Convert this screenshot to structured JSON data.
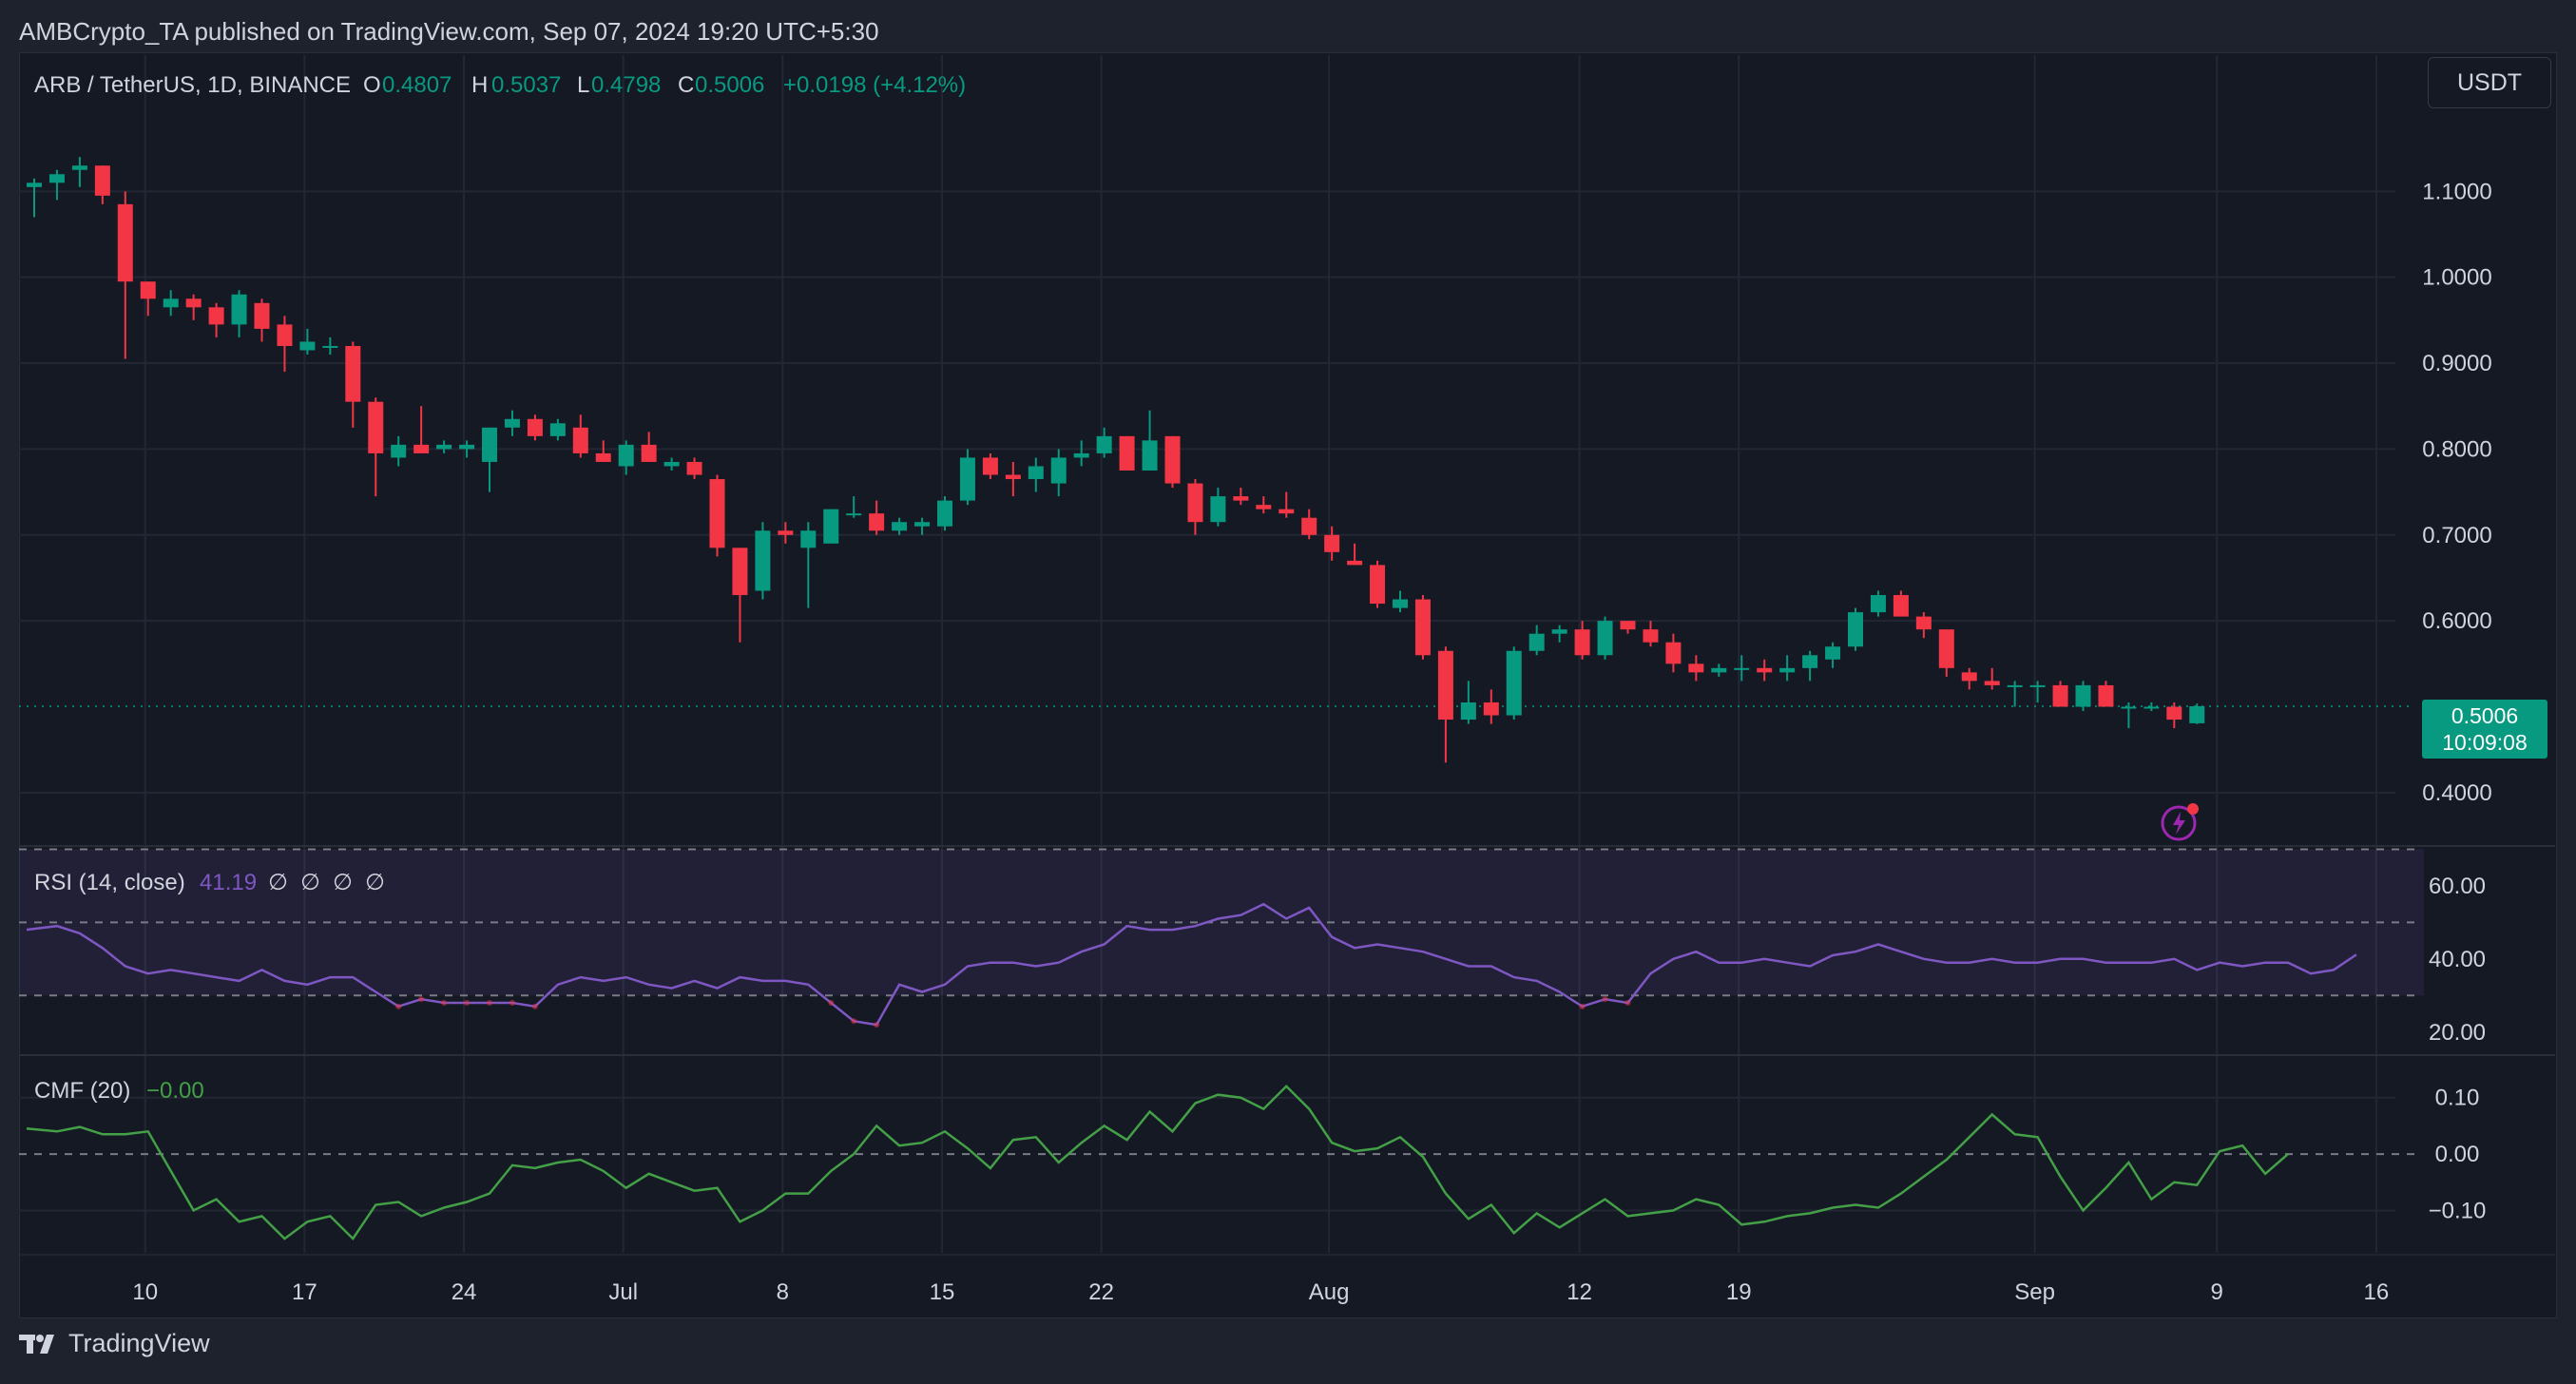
{
  "publisher": "AMBCrypto_TA published on TradingView.com, Sep 07, 2024 19:20 UTC+5:30",
  "header": {
    "symbol": "ARB / TetherUS, 1D, BINANCE",
    "o_label": "O",
    "o_value": "0.4807",
    "h_label": "H",
    "h_value": "0.5037",
    "l_label": "L",
    "l_value": "0.4798",
    "c_label": "C",
    "c_value": "0.5006",
    "change": "+0.0198 (+4.12%)"
  },
  "currency_button": "USDT",
  "price_badge": {
    "price": "0.5006",
    "countdown": "10:09:08"
  },
  "footer": {
    "brand": "TradingView"
  },
  "colors": {
    "up": "#089981",
    "down": "#f23645",
    "rsi": "#7e57c2",
    "cmf": "#43a047",
    "grid": "#232733",
    "text": "#d1d4dc"
  },
  "chart_data": [
    {
      "type": "candlestick",
      "title": "ARB / TetherUS, 1D, BINANCE",
      "y_ticks": [
        "1.1000",
        "1.0000",
        "0.9000",
        "0.8000",
        "0.7000",
        "0.6000",
        "0.4000"
      ],
      "ylim": [
        0.36,
        1.19
      ],
      "x_ticks": [
        "10",
        "17",
        "24",
        "Jul",
        "8",
        "15",
        "22",
        "Aug",
        "12",
        "19",
        "Sep",
        "9",
        "16"
      ],
      "ohlc": [
        [
          1.105,
          1.115,
          1.07,
          1.11
        ],
        [
          1.11,
          1.125,
          1.09,
          1.12
        ],
        [
          1.125,
          1.14,
          1.105,
          1.13
        ],
        [
          1.13,
          1.13,
          1.085,
          1.095
        ],
        [
          1.085,
          1.1,
          0.905,
          0.995
        ],
        [
          0.995,
          0.995,
          0.955,
          0.975
        ],
        [
          0.965,
          0.985,
          0.955,
          0.975
        ],
        [
          0.975,
          0.98,
          0.95,
          0.965
        ],
        [
          0.965,
          0.97,
          0.93,
          0.945
        ],
        [
          0.945,
          0.985,
          0.93,
          0.98
        ],
        [
          0.97,
          0.975,
          0.925,
          0.94
        ],
        [
          0.945,
          0.955,
          0.89,
          0.92
        ],
        [
          0.915,
          0.94,
          0.91,
          0.925
        ],
        [
          0.92,
          0.93,
          0.91,
          0.92
        ],
        [
          0.92,
          0.925,
          0.825,
          0.855
        ],
        [
          0.855,
          0.86,
          0.745,
          0.795
        ],
        [
          0.79,
          0.815,
          0.78,
          0.805
        ],
        [
          0.805,
          0.85,
          0.795,
          0.795
        ],
        [
          0.8,
          0.81,
          0.795,
          0.805
        ],
        [
          0.8,
          0.81,
          0.79,
          0.805
        ],
        [
          0.785,
          0.825,
          0.75,
          0.825
        ],
        [
          0.825,
          0.845,
          0.815,
          0.835
        ],
        [
          0.835,
          0.84,
          0.81,
          0.815
        ],
        [
          0.815,
          0.835,
          0.81,
          0.83
        ],
        [
          0.825,
          0.84,
          0.79,
          0.795
        ],
        [
          0.795,
          0.81,
          0.785,
          0.785
        ],
        [
          0.78,
          0.81,
          0.77,
          0.805
        ],
        [
          0.805,
          0.82,
          0.785,
          0.785
        ],
        [
          0.78,
          0.79,
          0.775,
          0.785
        ],
        [
          0.785,
          0.79,
          0.765,
          0.77
        ],
        [
          0.765,
          0.77,
          0.675,
          0.685
        ],
        [
          0.685,
          0.685,
          0.575,
          0.63
        ],
        [
          0.635,
          0.715,
          0.625,
          0.705
        ],
        [
          0.705,
          0.715,
          0.69,
          0.7
        ],
        [
          0.685,
          0.715,
          0.615,
          0.705
        ],
        [
          0.69,
          0.73,
          0.69,
          0.73
        ],
        [
          0.725,
          0.745,
          0.72,
          0.725
        ],
        [
          0.725,
          0.74,
          0.7,
          0.705
        ],
        [
          0.705,
          0.72,
          0.7,
          0.715
        ],
        [
          0.71,
          0.72,
          0.7,
          0.715
        ],
        [
          0.71,
          0.745,
          0.705,
          0.74
        ],
        [
          0.74,
          0.8,
          0.735,
          0.79
        ],
        [
          0.79,
          0.795,
          0.765,
          0.77
        ],
        [
          0.77,
          0.785,
          0.745,
          0.765
        ],
        [
          0.765,
          0.79,
          0.75,
          0.78
        ],
        [
          0.76,
          0.8,
          0.745,
          0.79
        ],
        [
          0.79,
          0.81,
          0.78,
          0.795
        ],
        [
          0.795,
          0.825,
          0.79,
          0.815
        ],
        [
          0.815,
          0.815,
          0.775,
          0.775
        ],
        [
          0.775,
          0.845,
          0.775,
          0.81
        ],
        [
          0.815,
          0.815,
          0.755,
          0.76
        ],
        [
          0.76,
          0.765,
          0.7,
          0.715
        ],
        [
          0.715,
          0.755,
          0.71,
          0.745
        ],
        [
          0.745,
          0.755,
          0.735,
          0.74
        ],
        [
          0.735,
          0.745,
          0.725,
          0.73
        ],
        [
          0.73,
          0.75,
          0.72,
          0.725
        ],
        [
          0.72,
          0.73,
          0.695,
          0.7
        ],
        [
          0.7,
          0.71,
          0.67,
          0.68
        ],
        [
          0.67,
          0.69,
          0.665,
          0.665
        ],
        [
          0.665,
          0.67,
          0.615,
          0.62
        ],
        [
          0.615,
          0.635,
          0.61,
          0.625
        ],
        [
          0.625,
          0.63,
          0.555,
          0.56
        ],
        [
          0.565,
          0.57,
          0.435,
          0.485
        ],
        [
          0.485,
          0.53,
          0.48,
          0.505
        ],
        [
          0.505,
          0.52,
          0.48,
          0.49
        ],
        [
          0.49,
          0.57,
          0.485,
          0.565
        ],
        [
          0.565,
          0.595,
          0.56,
          0.585
        ],
        [
          0.585,
          0.595,
          0.575,
          0.59
        ],
        [
          0.59,
          0.6,
          0.555,
          0.56
        ],
        [
          0.56,
          0.605,
          0.555,
          0.6
        ],
        [
          0.6,
          0.6,
          0.585,
          0.59
        ],
        [
          0.59,
          0.6,
          0.57,
          0.575
        ],
        [
          0.575,
          0.585,
          0.54,
          0.55
        ],
        [
          0.55,
          0.56,
          0.53,
          0.54
        ],
        [
          0.54,
          0.55,
          0.535,
          0.545
        ],
        [
          0.545,
          0.56,
          0.53,
          0.545
        ],
        [
          0.545,
          0.555,
          0.53,
          0.54
        ],
        [
          0.54,
          0.56,
          0.53,
          0.545
        ],
        [
          0.545,
          0.565,
          0.53,
          0.56
        ],
        [
          0.555,
          0.575,
          0.545,
          0.57
        ],
        [
          0.57,
          0.615,
          0.565,
          0.61
        ],
        [
          0.61,
          0.635,
          0.605,
          0.63
        ],
        [
          0.63,
          0.635,
          0.605,
          0.605
        ],
        [
          0.605,
          0.61,
          0.58,
          0.59
        ],
        [
          0.59,
          0.59,
          0.535,
          0.545
        ],
        [
          0.54,
          0.545,
          0.52,
          0.53
        ],
        [
          0.53,
          0.545,
          0.52,
          0.525
        ],
        [
          0.525,
          0.53,
          0.5,
          0.525
        ],
        [
          0.525,
          0.53,
          0.505,
          0.525
        ],
        [
          0.525,
          0.53,
          0.5,
          0.5
        ],
        [
          0.5,
          0.53,
          0.495,
          0.525
        ],
        [
          0.525,
          0.53,
          0.5,
          0.5
        ],
        [
          0.5,
          0.505,
          0.475,
          0.5
        ],
        [
          0.5,
          0.505,
          0.495,
          0.5
        ],
        [
          0.5,
          0.505,
          0.475,
          0.485
        ],
        [
          0.4807,
          0.5037,
          0.4798,
          0.5006
        ]
      ]
    },
    {
      "type": "line",
      "title": "RSI (14, close)",
      "value_label": "41.19",
      "extra_labels": [
        "∅",
        "∅",
        "∅",
        "∅"
      ],
      "y_ticks": [
        "60.00",
        "40.00",
        "20.00"
      ],
      "ylim": [
        15,
        67
      ],
      "bands": [
        30,
        50,
        70
      ],
      "values": [
        48,
        49,
        47,
        43,
        38,
        36,
        37,
        36,
        35,
        34,
        37,
        34,
        33,
        35,
        35,
        31,
        27,
        29,
        28,
        28,
        28,
        28,
        27,
        33,
        35,
        34,
        35,
        33,
        32,
        34,
        32,
        35,
        34,
        34,
        33,
        28,
        23,
        22,
        33,
        31,
        33,
        38,
        39,
        39,
        38,
        39,
        42,
        44,
        49,
        48,
        48,
        49,
        51,
        52,
        55,
        51,
        54,
        46,
        43,
        44,
        43,
        42,
        40,
        38,
        38,
        35,
        34,
        31,
        27,
        29,
        28,
        36,
        40,
        42,
        39,
        39,
        40,
        39,
        38,
        41,
        42,
        44,
        42,
        40,
        39,
        39,
        40,
        39,
        39,
        40,
        40,
        39,
        39,
        39,
        40,
        37,
        39,
        38,
        39,
        39,
        36,
        37,
        41.19
      ]
    },
    {
      "type": "line",
      "title": "CMF (20)",
      "value_label": "−0.00",
      "y_ticks": [
        "0.10",
        "0.00",
        "−0.10"
      ],
      "ylim": [
        -0.17,
        0.15
      ],
      "values": [
        0.045,
        0.04,
        0.048,
        0.035,
        0.035,
        0.04,
        -0.03,
        -0.1,
        -0.08,
        -0.12,
        -0.11,
        -0.15,
        -0.12,
        -0.11,
        -0.15,
        -0.09,
        -0.085,
        -0.11,
        -0.095,
        -0.085,
        -0.07,
        -0.02,
        -0.025,
        -0.015,
        -0.01,
        -0.03,
        -0.06,
        -0.035,
        -0.05,
        -0.065,
        -0.06,
        -0.12,
        -0.1,
        -0.07,
        -0.07,
        -0.03,
        0.0,
        0.05,
        0.015,
        0.02,
        0.04,
        0.01,
        -0.025,
        0.025,
        0.03,
        -0.015,
        0.02,
        0.05,
        0.025,
        0.075,
        0.04,
        0.09,
        0.105,
        0.1,
        0.08,
        0.12,
        0.08,
        0.02,
        0.005,
        0.01,
        0.03,
        -0.005,
        -0.07,
        -0.115,
        -0.09,
        -0.14,
        -0.105,
        -0.13,
        -0.105,
        -0.08,
        -0.11,
        -0.105,
        -0.1,
        -0.08,
        -0.09,
        -0.125,
        -0.12,
        -0.11,
        -0.105,
        -0.095,
        -0.09,
        -0.095,
        -0.07,
        -0.04,
        -0.01,
        0.03,
        0.07,
        0.035,
        0.03,
        -0.04,
        -0.1,
        -0.06,
        -0.015,
        -0.08,
        -0.05,
        -0.055,
        0.005,
        0.015,
        -0.035,
        -0.0
      ]
    }
  ]
}
